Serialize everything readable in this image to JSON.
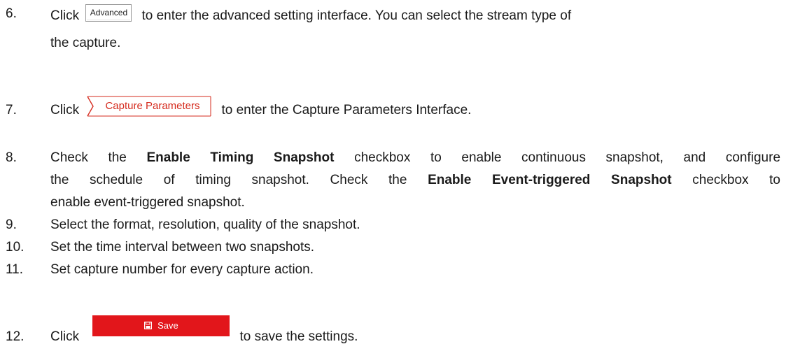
{
  "steps": [
    {
      "num": "6.",
      "lines": {
        "click": "Click",
        "after_button": "to enter the advanced setting interface. You can select the stream type of",
        "line2": "the capture."
      },
      "button_label": "Advanced"
    },
    {
      "num": "7.",
      "click": "Click",
      "tab_label": "Capture Parameters",
      "after": "to enter the Capture Parameters Interface."
    },
    {
      "num": "8.",
      "line1_pre": "Check the",
      "bold1": "Enable Timing Snapshot",
      "line1_post": "checkbox to enable continuous snapshot, and configure",
      "line2_pre": "the schedule of timing snapshot. Check the",
      "bold2": "Enable Event-triggered Snapshot",
      "line2_post": "checkbox to",
      "line3": "enable event-triggered snapshot."
    },
    {
      "num": "9.",
      "text": "Select the format, resolution, quality of the snapshot."
    },
    {
      "num": "10.",
      "text": "Set the time interval between two snapshots."
    },
    {
      "num": "11.",
      "text": "Set capture number for every capture action."
    },
    {
      "num": "12.",
      "click": "Click",
      "button_label": "Save",
      "button_icon": "floppy-disk-icon",
      "after": "to save the settings."
    }
  ],
  "colors": {
    "accent_red": "#e2161b",
    "tab_text_red": "#d52b1e",
    "text": "#1a1a1a"
  }
}
